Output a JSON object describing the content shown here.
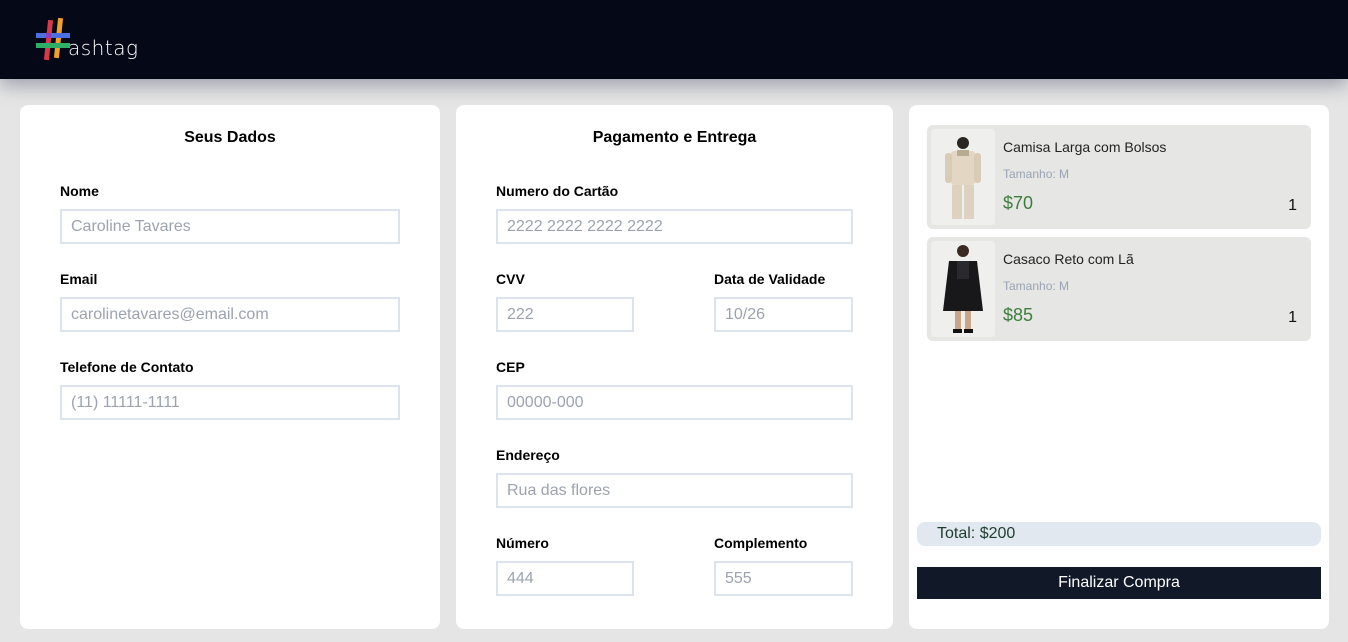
{
  "header": {
    "logo_text": "ashtag"
  },
  "seus_dados": {
    "title": "Seus Dados",
    "nome": {
      "label": "Nome",
      "placeholder": "Caroline Tavares"
    },
    "email": {
      "label": "Email",
      "placeholder": "carolinetavares@email.com"
    },
    "telefone": {
      "label": "Telefone de Contato",
      "placeholder": "(11) 11111-1111"
    }
  },
  "pagamento": {
    "title": "Pagamento e Entrega",
    "cartao": {
      "label": "Numero do Cartão",
      "placeholder": "2222 2222 2222 2222"
    },
    "cvv": {
      "label": "CVV",
      "placeholder": "222"
    },
    "validade": {
      "label": "Data de Validade",
      "placeholder": "10/26"
    },
    "cep": {
      "label": "CEP",
      "placeholder": "00000-000"
    },
    "endereco": {
      "label": "Endereço",
      "placeholder": "Rua das flores"
    },
    "numero": {
      "label": "Número",
      "placeholder": "444"
    },
    "complemento": {
      "label": "Complemento",
      "placeholder": "555"
    }
  },
  "carrinho": {
    "items": [
      {
        "name": "Camisa Larga com Bolsos",
        "size": "Tamanho: M",
        "price": "$70",
        "qty": "1"
      },
      {
        "name": "Casaco Reto com Lã",
        "size": "Tamanho: M",
        "price": "$85",
        "qty": "1"
      }
    ],
    "total": "Total: $200",
    "button": "Finalizar Compra"
  },
  "colors": {
    "header_bg": "#050816",
    "button_bg": "#111827",
    "price": "#3f7d3f",
    "total_bg": "#e2e8f0"
  }
}
